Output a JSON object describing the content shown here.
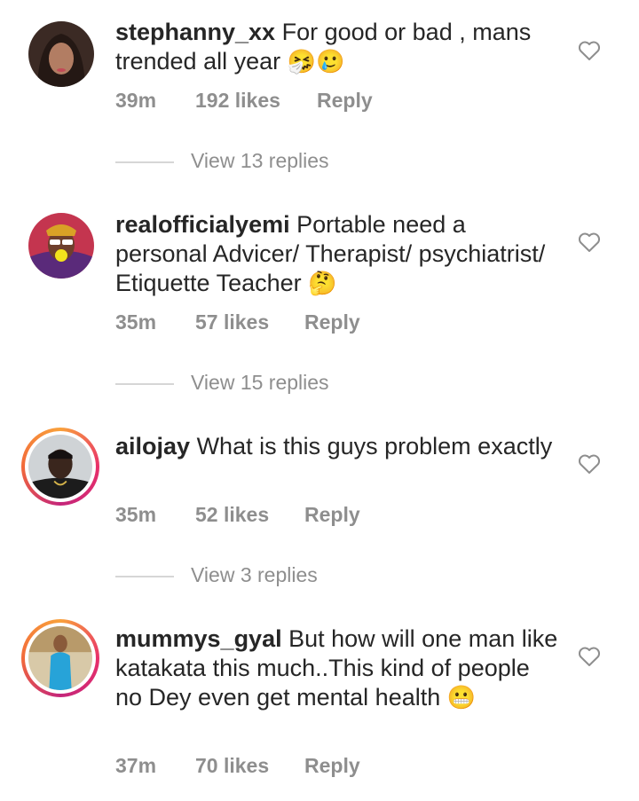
{
  "comments": [
    {
      "username": "stephanny_xx",
      "text": "For good or bad , mans trended all year",
      "emoji": "🤧🥲",
      "time": "39m",
      "likes": "192 likes",
      "reply": "Reply",
      "view_replies": "View 13 replies"
    },
    {
      "username": "realofficialyemi",
      "text": "Portable need a personal Advicer/ Therapist/ psychiatrist/ Etiquette Teacher",
      "emoji": "🤔",
      "time": "35m",
      "likes": "57 likes",
      "reply": "Reply",
      "view_replies": "View 15 replies"
    },
    {
      "username": "ailojay",
      "text": "What is this guys problem exactly",
      "emoji": "",
      "time": "35m",
      "likes": "52 likes",
      "reply": "Reply",
      "view_replies": "View 3 replies"
    },
    {
      "username": "mummys_gyal",
      "text": "But how will one man like katakata this much..This kind of people no Dey even get mental health",
      "emoji": "😬",
      "time": "37m",
      "likes": "70 likes",
      "reply": "Reply"
    }
  ],
  "colors": {
    "text": "#262626",
    "secondary": "#8e8e8e",
    "story_ring_start": "#f9a13b",
    "story_ring_end": "#c4257a"
  },
  "icons": {
    "like": "heart-outline-icon"
  }
}
